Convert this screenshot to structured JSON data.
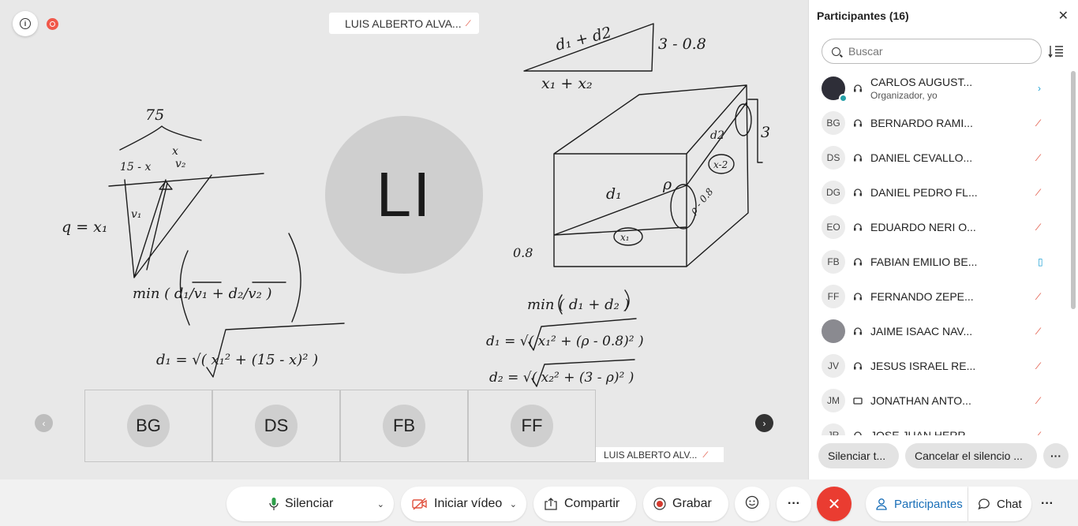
{
  "stage": {
    "presenter_name": "LUIS ALBERTO ALVA...",
    "presenter_initials": "LI",
    "self_label": "LUIS ALBERTO ALV...",
    "thumbnails": [
      {
        "initials": "BG"
      },
      {
        "initials": "DS"
      },
      {
        "initials": "FB"
      },
      {
        "initials": "FF"
      }
    ]
  },
  "whiteboard": {
    "annotations": [
      {
        "text": "d₁ + d2"
      },
      {
        "text": "3 - 0.8"
      },
      {
        "text": "x₁ + x₂"
      },
      {
        "text": "75"
      },
      {
        "text": "15 - x"
      },
      {
        "text": "x"
      },
      {
        "text": "v₂"
      },
      {
        "text": "v₁"
      },
      {
        "text": "q = x₁"
      },
      {
        "text": "d₁"
      },
      {
        "text": "ρ"
      },
      {
        "text": "d2"
      },
      {
        "text": "x-2"
      },
      {
        "text": "3"
      },
      {
        "text": "0.8"
      },
      {
        "text": "x₁"
      },
      {
        "text": "ρ - 0.8"
      },
      {
        "text": "min ( d₁/v₁ + d₂/v₂ )"
      },
      {
        "text": "d₁ = √( x₁² + (15 - x)² )"
      },
      {
        "text": "min ( d₁ + d₂ )"
      },
      {
        "text": "d₁ = √( x₁² + (ρ - 0.8)² )"
      },
      {
        "text": "d₂ = √( x₂² + (3 - ρ)² )"
      }
    ]
  },
  "panel": {
    "title": "Participantes (16)",
    "search_placeholder": "Buscar",
    "participants": [
      {
        "initials": "",
        "name": "CARLOS AUGUST...",
        "sub": "Organizador, yo",
        "status": "speaking",
        "avatar": "photo"
      },
      {
        "initials": "BG",
        "name": "BERNARDO RAMI...",
        "sub": "",
        "status": "muted",
        "avatar": "initials"
      },
      {
        "initials": "DS",
        "name": "DANIEL CEVALLO...",
        "sub": "",
        "status": "muted",
        "avatar": "initials"
      },
      {
        "initials": "DG",
        "name": "DANIEL PEDRO FL...",
        "sub": "",
        "status": "muted",
        "avatar": "initials"
      },
      {
        "initials": "EO",
        "name": "EDUARDO NERI O...",
        "sub": "",
        "status": "muted",
        "avatar": "initials"
      },
      {
        "initials": "FB",
        "name": "FABIAN EMILIO BE...",
        "sub": "",
        "status": "on",
        "avatar": "initials"
      },
      {
        "initials": "FF",
        "name": "FERNANDO ZEPE...",
        "sub": "",
        "status": "muted",
        "avatar": "initials"
      },
      {
        "initials": "",
        "name": "JAIME ISAAC NAV...",
        "sub": "",
        "status": "muted",
        "avatar": "photo"
      },
      {
        "initials": "JV",
        "name": "JESUS ISRAEL RE...",
        "sub": "",
        "status": "muted",
        "avatar": "initials"
      },
      {
        "initials": "JM",
        "name": "JONATHAN ANTO...",
        "sub": "",
        "status": "muted",
        "avatar": "initials"
      },
      {
        "initials": "JR",
        "name": "JOSE JUAN HERR...",
        "sub": "",
        "status": "muted",
        "avatar": "initials"
      }
    ],
    "mute_all_label": "Silenciar t...",
    "unmute_all_label": "Cancelar el silencio ...",
    "more_label": "···"
  },
  "controls": {
    "mute_label": "Silenciar",
    "video_label": "Iniciar vídeo",
    "share_label": "Compartir",
    "record_label": "Grabar",
    "more_label": "···",
    "leave_label": "✕",
    "participants_label": "Participantes",
    "chat_label": "Chat",
    "side_more_label": "···"
  },
  "colors": {
    "leave": "#ea3c31",
    "muted": "#e0523f",
    "active": "#1a6fb8",
    "mic_on": "#2e9e4a",
    "video_off": "#e0523f",
    "record": "#d43a2f"
  }
}
